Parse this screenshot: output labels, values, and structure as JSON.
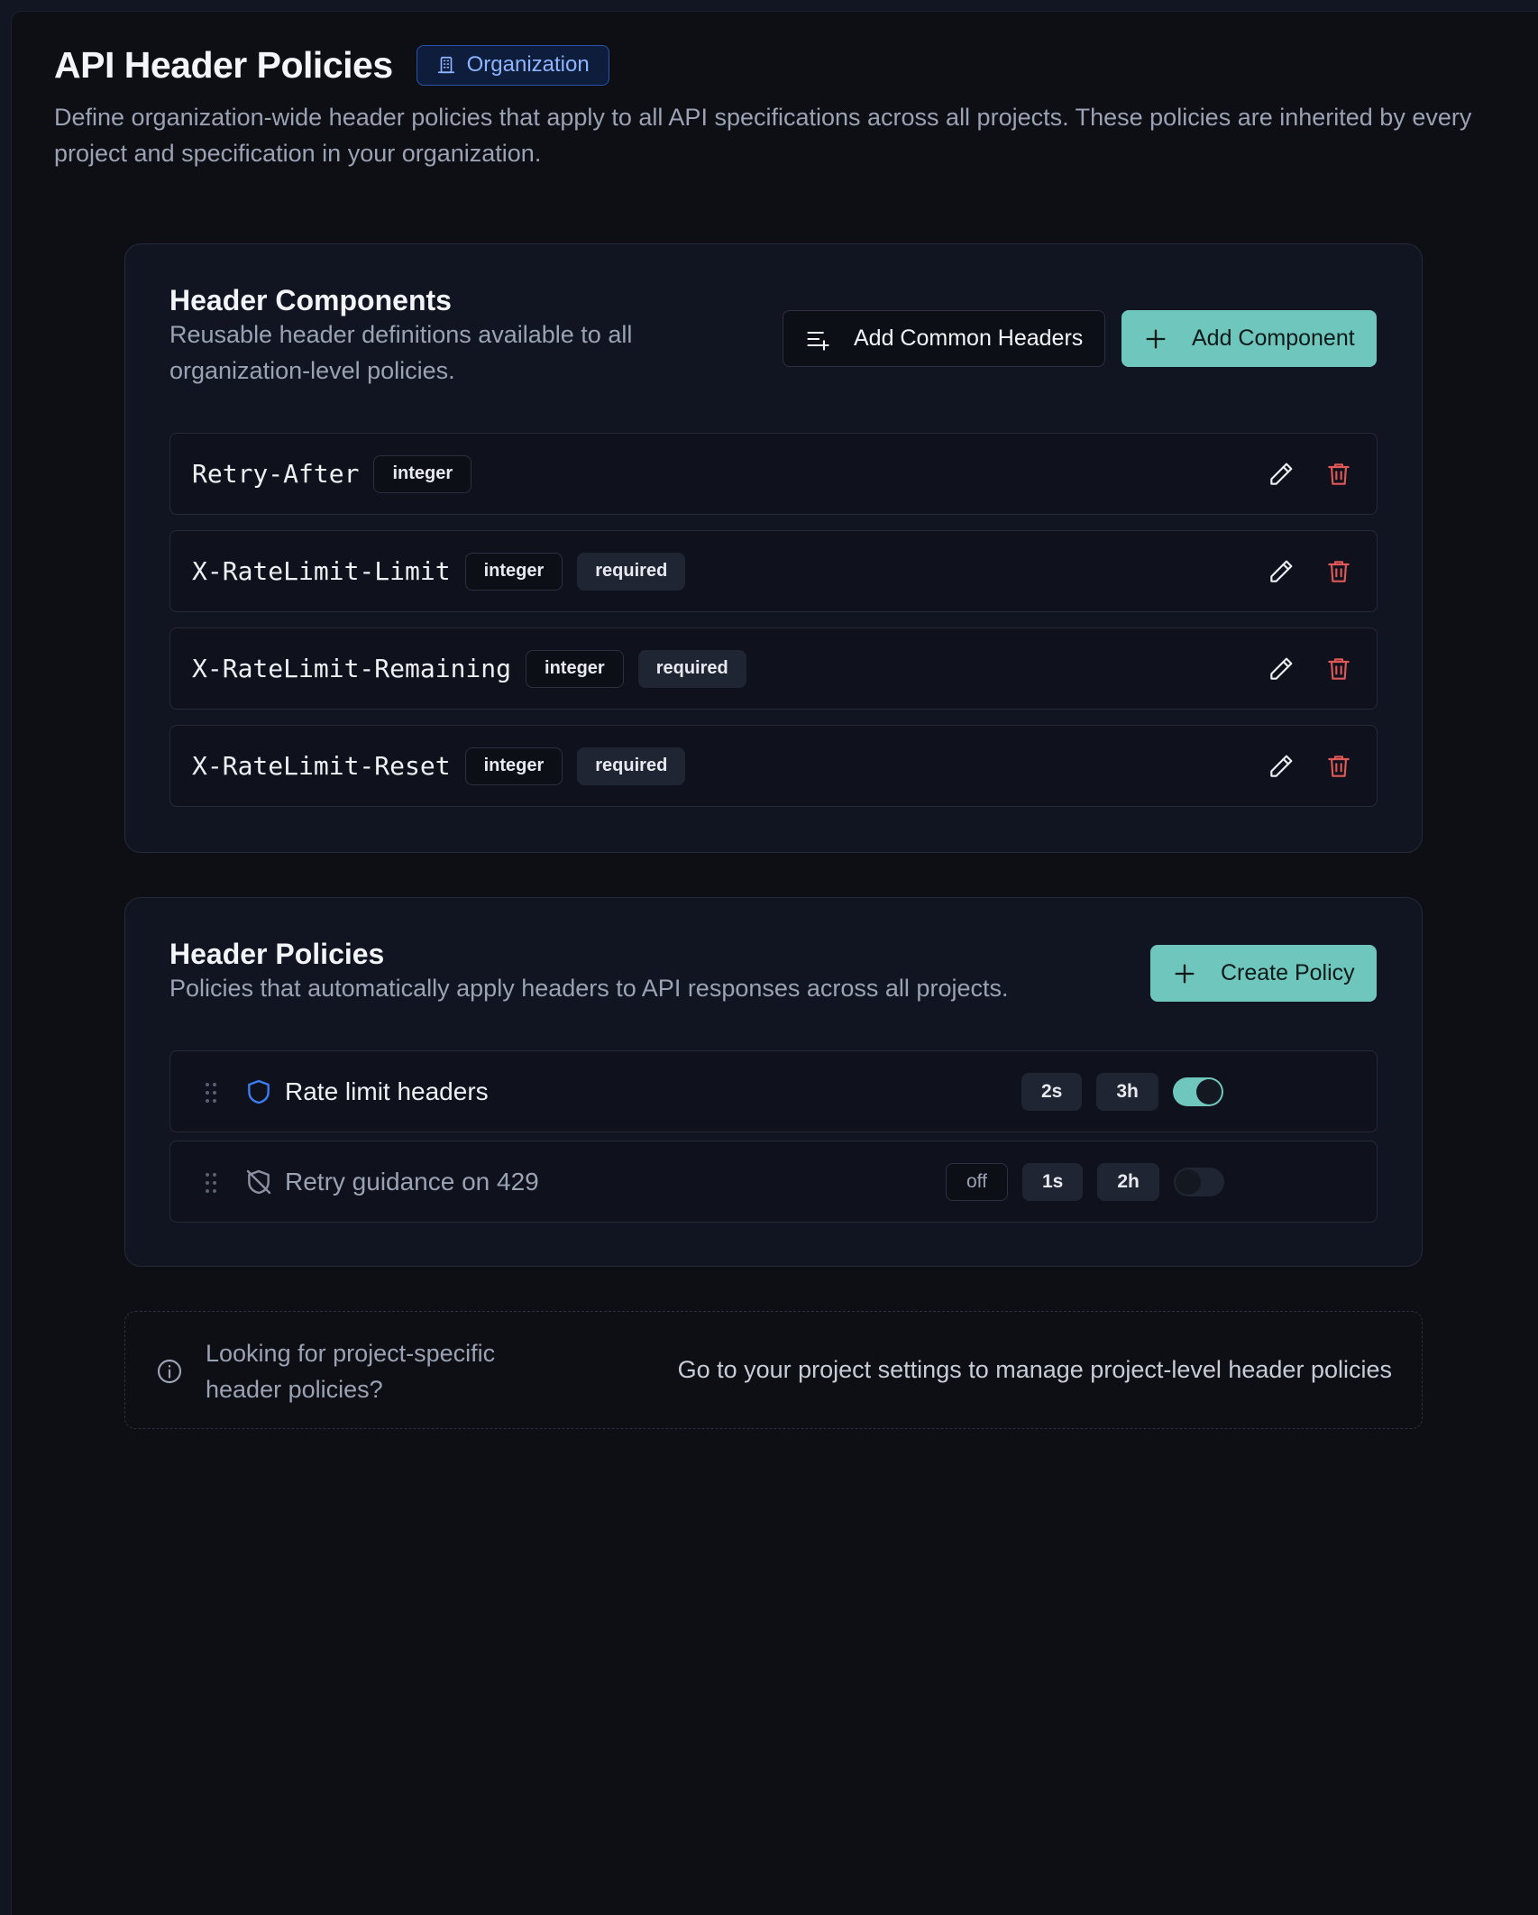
{
  "header": {
    "title": "API Header Policies",
    "badge": "Organization",
    "description": "Define organization-wide header policies that apply to all API specifications across all projects. These policies are inherited by every project and specification in your organization."
  },
  "components": {
    "title": "Header Components",
    "subtitle_line1": "Reusable header definitions available to all",
    "subtitle_line2": "organization-level policies.",
    "add_common_label": "Add Common Headers",
    "add_component_label": "Add Component",
    "items": [
      {
        "name": "Retry-After",
        "type": "integer",
        "required": ""
      },
      {
        "name": "X-RateLimit-Limit",
        "type": "integer",
        "required": "required"
      },
      {
        "name": "X-RateLimit-Remaining",
        "type": "integer",
        "required": "required"
      },
      {
        "name": "X-RateLimit-Reset",
        "type": "integer",
        "required": "required"
      }
    ]
  },
  "policies": {
    "title": "Header Policies",
    "subtitle": "Policies that automatically apply headers to API responses across all projects.",
    "create_label": "Create Policy",
    "items": [
      {
        "name": "Rate limit headers",
        "status": "",
        "chip1": "2s",
        "chip2": "3h",
        "enabled": true
      },
      {
        "name": "Retry guidance on 429",
        "status": "off",
        "chip1": "1s",
        "chip2": "2h",
        "enabled": false
      }
    ]
  },
  "info": {
    "question": "Looking for project-specific header policies?",
    "link": "Go to your project settings to manage project-level header policies"
  },
  "colors": {
    "accent": "#6ec6bd",
    "danger": "#e05858",
    "badge_blue": "#8db4ff"
  }
}
